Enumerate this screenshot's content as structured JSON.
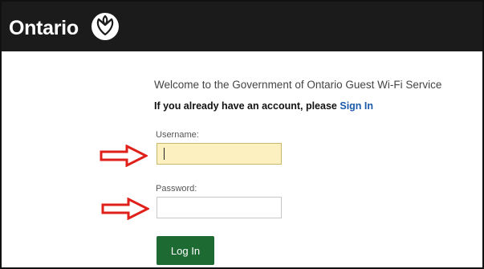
{
  "header": {
    "brand": "Ontario",
    "logo_icon": "ontario-trillium-icon",
    "background_color": "#1b1b1b"
  },
  "main": {
    "welcome_text": "Welcome to the Government of Ontario Guest Wi-Fi Service",
    "account_prompt": "If you already have an account, please",
    "sign_in_link": "Sign In",
    "username": {
      "label": "Username:",
      "value": ""
    },
    "password": {
      "label": "Password:",
      "value": ""
    },
    "login_button": "Log In",
    "login_button_color": "#1e6a33"
  },
  "annotations": {
    "arrow_icon": "red-arrow-icon",
    "arrow_color": "#e0201a"
  }
}
